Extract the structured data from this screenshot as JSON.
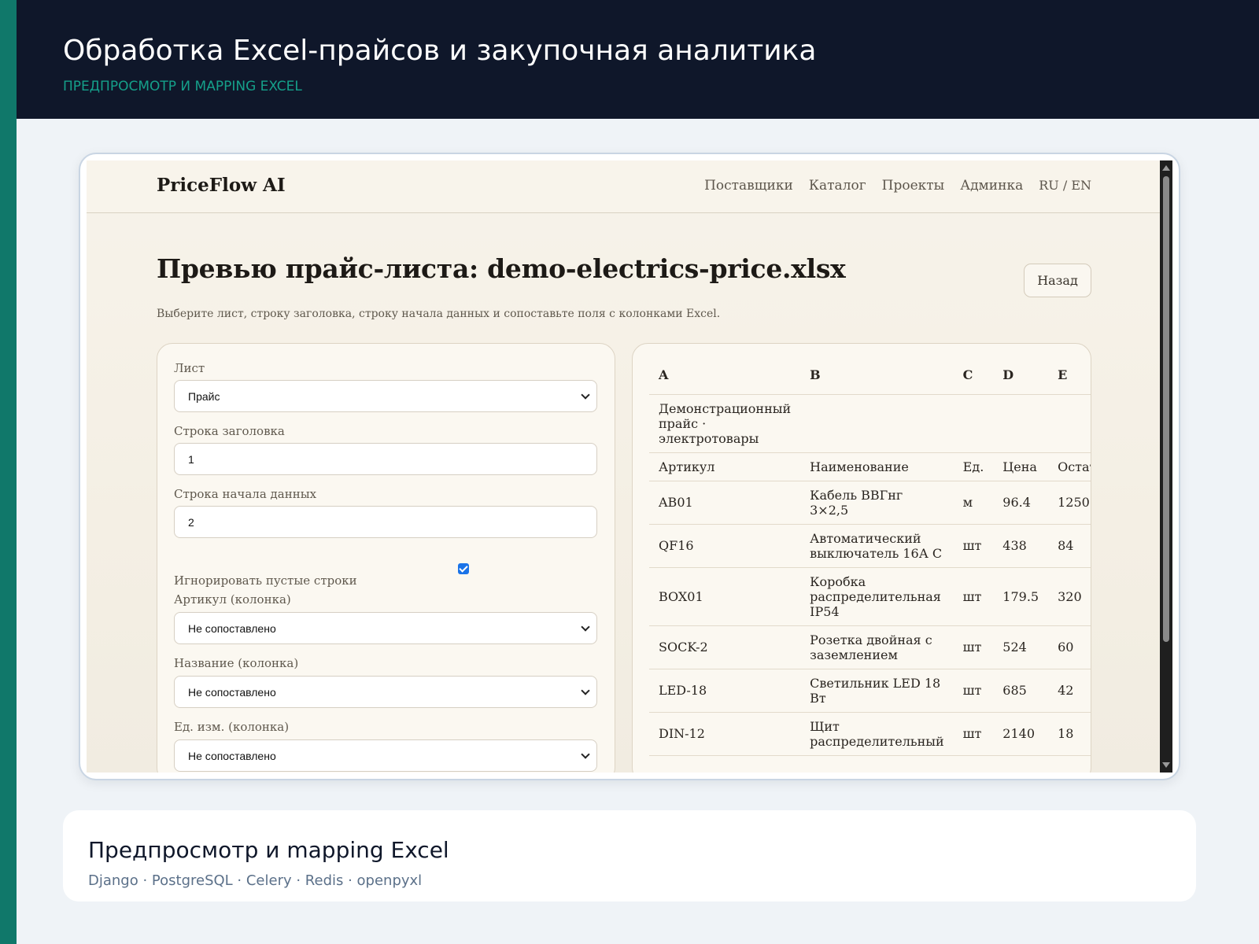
{
  "banner": {
    "title": "Обработка Excel-прайсов и закупочная аналитика",
    "subtitle": "Предпросмотр и mapping Excel"
  },
  "app": {
    "brand": "PriceFlow AI",
    "nav": [
      "Поставщики",
      "Каталог",
      "Проекты",
      "Админка",
      "RU / EN"
    ],
    "page_title": "Превью прайс-листа: demo-electrics-price.xlsx",
    "back_label": "Назад",
    "description": "Выберите лист, строку заголовка, строку начала данных и сопоставьте поля с колонками Excel."
  },
  "form": {
    "sheet_label": "Лист",
    "sheet_value": "Прайс",
    "header_row_label": "Строка заголовка",
    "header_row_value": "1",
    "data_start_label": "Строка начала данных",
    "data_start_value": "2",
    "ignore_empty_checked": true,
    "ignore_empty_label": "Игнорировать пустые строки",
    "mappings": [
      {
        "label": "Артикул (колонка)",
        "value": "Не сопоставлено"
      },
      {
        "label": "Название (колонка)",
        "value": "Не сопоставлено"
      },
      {
        "label": "Ед. изм. (колонка)",
        "value": "Не сопоставлено"
      }
    ]
  },
  "table": {
    "columns": [
      "A",
      "B",
      "C",
      "D",
      "E"
    ],
    "rows": [
      [
        "Демонстрационный прайс · электротовары",
        "",
        "",
        "",
        ""
      ],
      [
        "Артикул",
        "Наименование",
        "Ед.",
        "Цена",
        "Остаток"
      ],
      [
        "AB01",
        "Кабель ВВГнг 3×2,5",
        "м",
        "96.4",
        "1250"
      ],
      [
        "QF16",
        "Автоматический выключатель 16А C",
        "шт",
        "438",
        "84"
      ],
      [
        "BOX01",
        "Коробка распределительная IP54",
        "шт",
        "179.5",
        "320"
      ],
      [
        "SOCK-2",
        "Розетка двойная с заземлением",
        "шт",
        "524",
        "60"
      ],
      [
        "LED-18",
        "Светильник LED 18 Вт",
        "шт",
        "685",
        "42"
      ],
      [
        "DIN-12",
        "Щит распределительный",
        "шт",
        "2140",
        "18"
      ]
    ]
  },
  "caption": {
    "title": "Предпросмотр и mapping Excel",
    "stack": "Django · PostgreSQL · Celery · Redis · openpyxl"
  },
  "colors": {
    "accent": "#10786a",
    "banner_bg": "#0f172a",
    "subtitle": "#15a08a",
    "checkbox": "#1a73e8"
  }
}
